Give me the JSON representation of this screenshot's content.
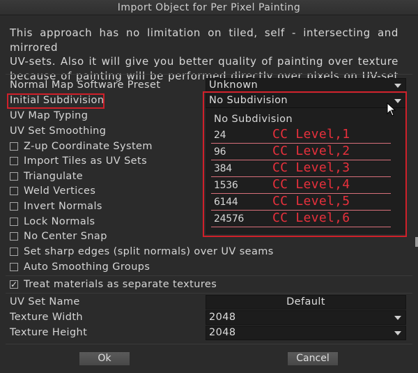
{
  "window": {
    "title": "Import Object for Per Pixel Painting"
  },
  "description": {
    "lines": [
      "This approach has no limitation on tiled, self - intersecting and mirrored",
      "UV-sets. Also it will give you better quality of painting over texture",
      "because of painting will be performed directly over pixels on UV-set"
    ]
  },
  "fields": {
    "normal_map_label": "Normal Map Software Preset",
    "normal_map_value": "Unknown",
    "initial_subdivision_label": "Initial Subdivision",
    "initial_subdivision_value": "No Subdivision",
    "uv_map_typing_label": "UV Map Typing",
    "uv_set_smoothing_label": "UV Set Smoothing"
  },
  "dropdown": {
    "options": [
      {
        "label": "No Subdivision"
      },
      {
        "label": "24",
        "note": "CC Level,1"
      },
      {
        "label": "96",
        "note": "CC Level,2"
      },
      {
        "label": "384",
        "note": "CC Level,3"
      },
      {
        "label": "1536",
        "note": "CC Level,4"
      },
      {
        "label": "6144",
        "note": "CC Level,5"
      },
      {
        "label": "24576",
        "note": "CC Level,6"
      }
    ]
  },
  "checkboxes": [
    {
      "label": "Z-up Coordinate System",
      "checked": false
    },
    {
      "label": "Import Tiles as UV Sets",
      "checked": false
    },
    {
      "label": "Triangulate",
      "checked": false
    },
    {
      "label": "Weld Vertices",
      "checked": false
    },
    {
      "label": "Invert Normals",
      "checked": false
    },
    {
      "label": "Lock Normals",
      "checked": false
    },
    {
      "label": "No Center Snap",
      "checked": false
    },
    {
      "label": "Set sharp edges (split normals) over UV seams",
      "checked": false
    },
    {
      "label": "Auto Smoothing Groups",
      "checked": false
    },
    {
      "label": "Treat materials as separate textures",
      "checked": true
    }
  ],
  "texture": {
    "uv_set_name_label": "UV Set Name",
    "uv_set_name_value": "Default",
    "width_label": "Texture Width",
    "width_value": "2048",
    "height_label": "Texture Height",
    "height_value": "2048"
  },
  "buttons": {
    "ok": "Ok",
    "cancel": "Cancel"
  },
  "colors": {
    "annotation_red": "#d0202a",
    "cc_level_text": "#e8303c",
    "background": "#2b2b2b"
  }
}
